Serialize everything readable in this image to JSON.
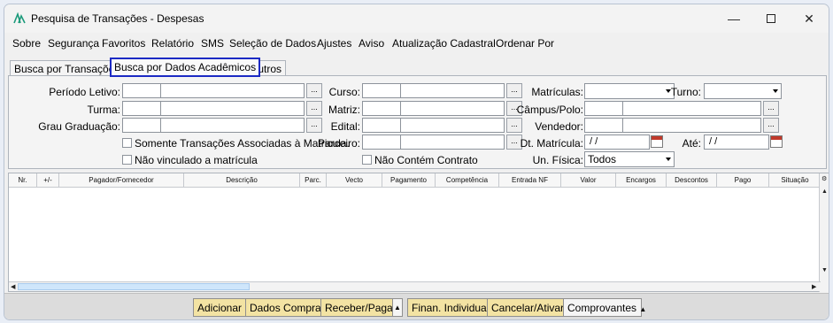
{
  "window": {
    "title": "Pesquisa de Transações - Despesas"
  },
  "menu": [
    "Sobre",
    "Segurança",
    "Favoritos",
    "Relatório",
    "SMS",
    "Seleção de Dados",
    "Ajustes",
    "Aviso",
    "Atualização Cadastral",
    "Ordenar Por"
  ],
  "tabs": [
    "Busca por Transações",
    "Busca por Dados Acadêmicos",
    "Outros"
  ],
  "form": {
    "periodo": "Período Letivo:",
    "turma": "Turma:",
    "grau": "Grau Graduação:",
    "curso": "Curso:",
    "matriz": "Matriz:",
    "edital": "Edital:",
    "parceiro": "Parceiro:",
    "matriculas": "Matrículas:",
    "turno": "Turno:",
    "campus": "Câmpus/Polo:",
    "vendedor": "Vendedor:",
    "dt_matricula": "Dt. Matrícula:",
    "ate": "Até:",
    "date_placeholder": "  /  /",
    "chk_somente": "Somente Transações Associadas à Matricula.",
    "chk_nao_vinc": "Não vinculado a matrícula",
    "chk_nao_contem": "Não Contém Contrato",
    "un_fisica": "Un. Física:",
    "un_fisica_value": "Todos",
    "dots": "..."
  },
  "grid": {
    "columns": [
      "Nr.",
      "+/-",
      "Pagador/Fornecedor",
      "Descrição",
      "Parc.",
      "Vecto",
      "Pagamento",
      "Competência",
      "Entrada NF",
      "Valor",
      "Encargos",
      "Descontos",
      "Pago",
      "Situação"
    ]
  },
  "footer": {
    "buttons": [
      "Adicionar",
      "Dados Compra",
      "Receber/Pagar",
      "Finan. Individual",
      "Cancelar/Ativar",
      "Comprovantes"
    ]
  },
  "colors": {
    "tab_highlight": "#1c2ac4",
    "button_yellow": "#f3e3a3"
  }
}
